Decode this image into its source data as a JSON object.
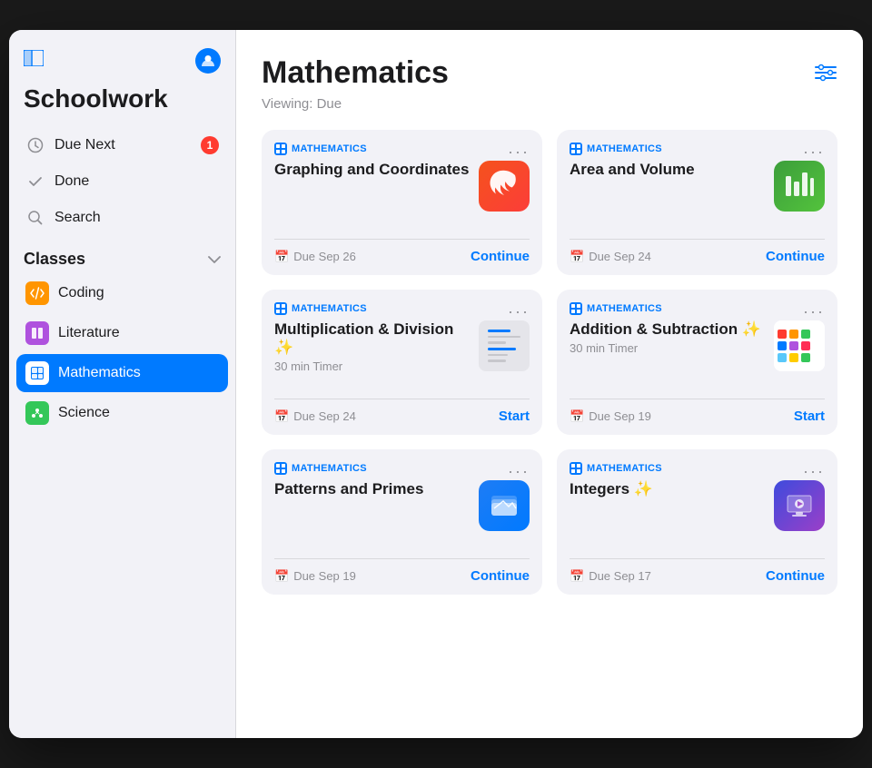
{
  "sidebar": {
    "toggle_icon": "⊞",
    "title": "Schoolwork",
    "nav": [
      {
        "id": "due-next",
        "label": "Due Next",
        "icon": "clock",
        "badge": 1
      },
      {
        "id": "done",
        "label": "Done",
        "icon": "check",
        "badge": null
      },
      {
        "id": "search",
        "label": "Search",
        "icon": "search",
        "badge": null
      }
    ],
    "classes_section": "Classes",
    "classes": [
      {
        "id": "coding",
        "label": "Coding",
        "icon": "orange",
        "active": false
      },
      {
        "id": "literature",
        "label": "Literature",
        "icon": "purple",
        "active": false
      },
      {
        "id": "mathematics",
        "label": "Mathematics",
        "icon": "blue",
        "active": true
      },
      {
        "id": "science",
        "label": "Science",
        "icon": "green",
        "active": false
      }
    ]
  },
  "main": {
    "page_title": "Mathematics",
    "viewing_label": "Viewing: Due",
    "filter_icon": "⊟",
    "cards": [
      {
        "id": "graphing",
        "category": "MATHEMATICS",
        "title": "Graphing and Coordinates",
        "subtitle": "",
        "app_icon_type": "swift",
        "due": "Due Sep 26",
        "action": "Continue"
      },
      {
        "id": "area-volume",
        "category": "MATHEMATICS",
        "title": "Area and Volume",
        "subtitle": "",
        "app_icon_type": "numbers",
        "due": "Due Sep 24",
        "action": "Continue"
      },
      {
        "id": "multiplication",
        "category": "MATHEMATICS",
        "title": "Multiplication & Division ✨",
        "subtitle": "30 min Timer",
        "app_icon_type": "thumbnail",
        "due": "Due Sep 24",
        "action": "Start"
      },
      {
        "id": "addition",
        "category": "MATHEMATICS",
        "title": "Addition & Subtraction ✨",
        "subtitle": "30 min Timer",
        "app_icon_type": "thumbnail-colored",
        "due": "Due Sep 19",
        "action": "Start"
      },
      {
        "id": "patterns",
        "category": "MATHEMATICS",
        "title": "Patterns and Primes",
        "subtitle": "",
        "app_icon_type": "files",
        "due": "Due Sep 19",
        "action": "Continue"
      },
      {
        "id": "integers",
        "category": "MATHEMATICS",
        "title": "Integers ✨",
        "subtitle": "",
        "app_icon_type": "keynote",
        "due": "Due Sep 17",
        "action": "Continue"
      }
    ]
  }
}
